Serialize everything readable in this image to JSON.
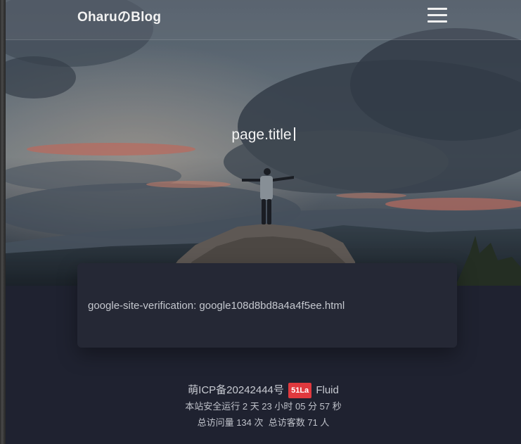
{
  "navbar": {
    "brand": "OharuのBlog",
    "menu_icon": "hamburger-menu-icon"
  },
  "banner": {
    "title": "page.title"
  },
  "card": {
    "text": "google-site-verification: google108d8bd8a4a4f5ee.html"
  },
  "footer": {
    "icp": "萌ICP备20242444号",
    "badge": "51La",
    "theme": "Fluid",
    "uptime": "本站安全运行 2 天 23 小时 05 分 57 秒",
    "visits": "总访问量 134 次",
    "visitors": "总访客数 71 人"
  },
  "colors": {
    "background": "#1f2230",
    "card": "#252835",
    "badge": "#e0393e"
  }
}
